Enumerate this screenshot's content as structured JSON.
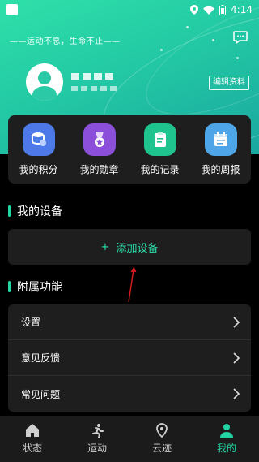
{
  "status_bar": {
    "time": "4:14"
  },
  "header": {
    "slogan": "——运动不息，生命不止——",
    "edit_profile": "编辑资料"
  },
  "quick_actions": [
    {
      "label": "我的积分",
      "icon": "points-icon",
      "color": "#4d7ae8"
    },
    {
      "label": "我的勋章",
      "icon": "medal-icon",
      "color": "#8b4fd9"
    },
    {
      "label": "我的记录",
      "icon": "record-icon",
      "color": "#1fc38e"
    },
    {
      "label": "我的周报",
      "icon": "weekly-report-icon",
      "color": "#4ea6e8"
    }
  ],
  "devices": {
    "title": "我的设备",
    "add_label": "添加设备"
  },
  "extras": {
    "title": "附属功能",
    "items": [
      {
        "label": "设置"
      },
      {
        "label": "意见反馈"
      },
      {
        "label": "常见问题"
      }
    ]
  },
  "tabs": [
    {
      "label": "状态",
      "icon": "home-icon",
      "active": false
    },
    {
      "label": "运动",
      "icon": "running-icon",
      "active": false
    },
    {
      "label": "云迹",
      "icon": "location-icon",
      "active": false
    },
    {
      "label": "我的",
      "icon": "user-icon",
      "active": true
    }
  ],
  "colors": {
    "accent": "#22d3a1",
    "card": "#1e1e1e",
    "background": "#000000"
  }
}
